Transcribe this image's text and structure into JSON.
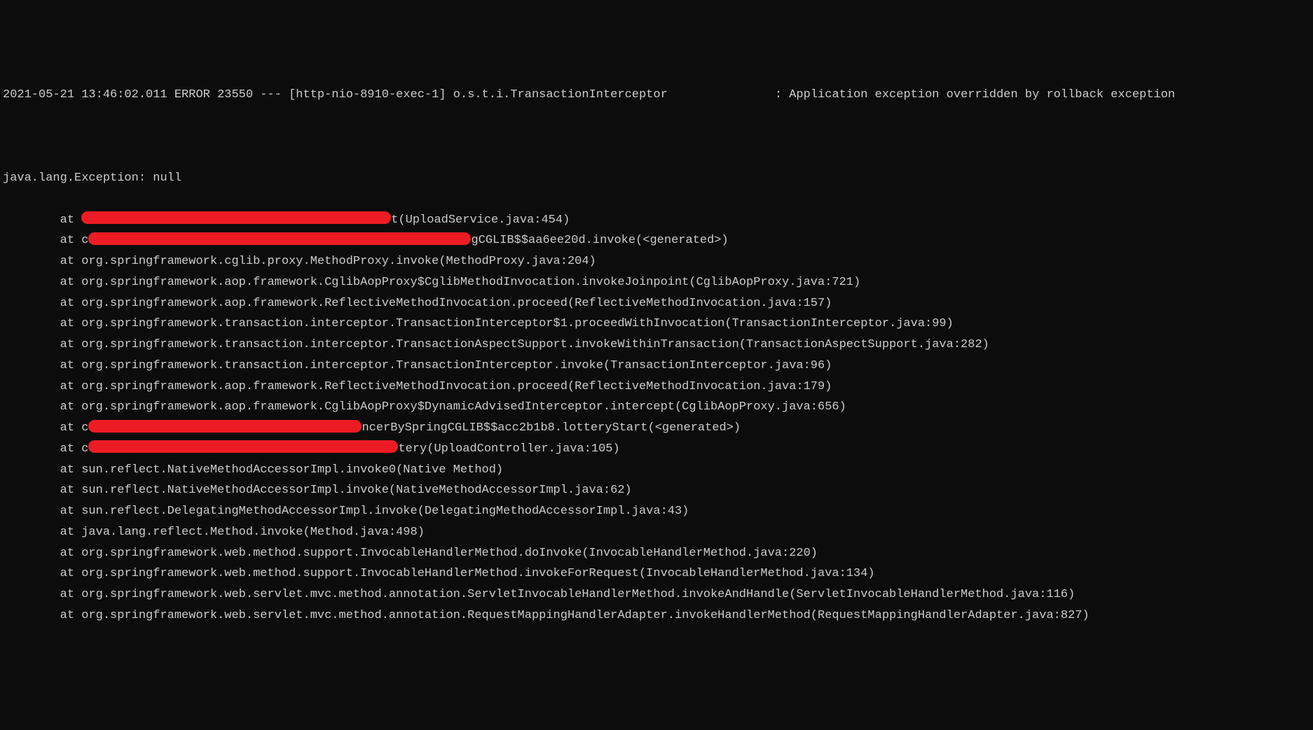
{
  "header": {
    "timestamp": "2021-05-21 13:46:02.011",
    "level": "ERROR",
    "pid": "23550",
    "separator": "---",
    "thread": "[http-nio-8910-exec-1]",
    "logger": "o.s.t.i.TransactionInterceptor",
    "message": ": Application exception overridden by rollback exception"
  },
  "exception": {
    "type": "java.lang.Exception",
    "msg": "null"
  },
  "stack": {
    "at": "at",
    "prefix_c": "c",
    "lines": [
      {
        "redacted": true,
        "red_width": 442,
        "pre": "",
        "suffix": "t(UploadService.java:454)"
      },
      {
        "redacted": true,
        "red_width": 546,
        "pre": "c",
        "suffix": "gCGLIB$$aa6ee20d.invoke(<generated>)"
      },
      {
        "redacted": false,
        "text": "org.springframework.cglib.proxy.MethodProxy.invoke(MethodProxy.java:204)"
      },
      {
        "redacted": false,
        "text": "org.springframework.aop.framework.CglibAopProxy$CglibMethodInvocation.invokeJoinpoint(CglibAopProxy.java:721)"
      },
      {
        "redacted": false,
        "text": "org.springframework.aop.framework.ReflectiveMethodInvocation.proceed(ReflectiveMethodInvocation.java:157)"
      },
      {
        "redacted": false,
        "text": "org.springframework.transaction.interceptor.TransactionInterceptor$1.proceedWithInvocation(TransactionInterceptor.java:99)"
      },
      {
        "redacted": false,
        "text": "org.springframework.transaction.interceptor.TransactionAspectSupport.invokeWithinTransaction(TransactionAspectSupport.java:282)"
      },
      {
        "redacted": false,
        "text": "org.springframework.transaction.interceptor.TransactionInterceptor.invoke(TransactionInterceptor.java:96)"
      },
      {
        "redacted": false,
        "text": "org.springframework.aop.framework.ReflectiveMethodInvocation.proceed(ReflectiveMethodInvocation.java:179)"
      },
      {
        "redacted": false,
        "text": "org.springframework.aop.framework.CglibAopProxy$DynamicAdvisedInterceptor.intercept(CglibAopProxy.java:656)"
      },
      {
        "redacted": true,
        "red_width": 390,
        "pre": "c",
        "suffix": "ncerBySpringCGLIB$$acc2b1b8.lotteryStart(<generated>)"
      },
      {
        "redacted": true,
        "red_width": 442,
        "pre": "c",
        "suffix": "tery(UploadController.java:105)"
      },
      {
        "redacted": false,
        "text": "sun.reflect.NativeMethodAccessorImpl.invoke0(Native Method)"
      },
      {
        "redacted": false,
        "text": "sun.reflect.NativeMethodAccessorImpl.invoke(NativeMethodAccessorImpl.java:62)"
      },
      {
        "redacted": false,
        "text": "sun.reflect.DelegatingMethodAccessorImpl.invoke(DelegatingMethodAccessorImpl.java:43)"
      },
      {
        "redacted": false,
        "text": "java.lang.reflect.Method.invoke(Method.java:498)"
      },
      {
        "redacted": false,
        "text": "org.springframework.web.method.support.InvocableHandlerMethod.doInvoke(InvocableHandlerMethod.java:220)"
      },
      {
        "redacted": false,
        "text": "org.springframework.web.method.support.InvocableHandlerMethod.invokeForRequest(InvocableHandlerMethod.java:134)"
      },
      {
        "redacted": false,
        "text": "org.springframework.web.servlet.mvc.method.annotation.ServletInvocableHandlerMethod.invokeAndHandle(ServletInvocableHandlerMethod.java:116)"
      },
      {
        "redacted": false,
        "text": "org.springframework.web.servlet.mvc.method.annotation.RequestMappingHandlerAdapter.invokeHandlerMethod(RequestMappingHandlerAdapter.java:827)"
      }
    ]
  }
}
